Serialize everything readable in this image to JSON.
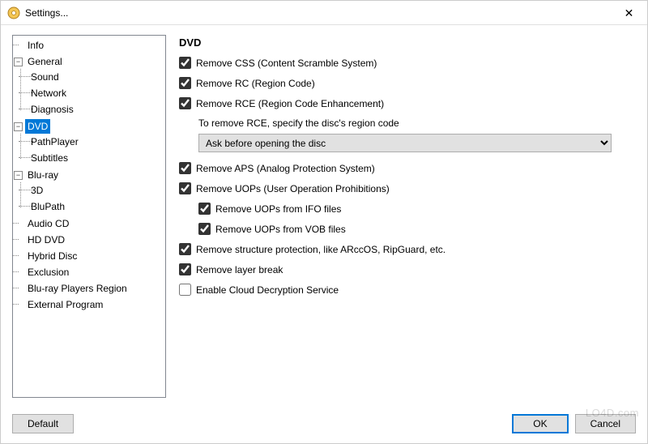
{
  "window": {
    "title": "Settings...",
    "close_symbol": "✕"
  },
  "tree": {
    "info": "Info",
    "general": "General",
    "general_children": {
      "sound": "Sound",
      "network": "Network",
      "diagnosis": "Diagnosis"
    },
    "dvd": "DVD",
    "dvd_children": {
      "pathplayer": "PathPlayer",
      "subtitles": "Subtitles"
    },
    "bluray": "Blu-ray",
    "bluray_children": {
      "threed": "3D",
      "blupath": "BluPath"
    },
    "audiocd": "Audio CD",
    "hddvd": "HD DVD",
    "hybrid": "Hybrid Disc",
    "exclusion": "Exclusion",
    "players_region": "Blu-ray Players Region",
    "external": "External Program",
    "expander_minus": "−"
  },
  "panel": {
    "heading": "DVD",
    "remove_css": "Remove CSS (Content Scramble System)",
    "remove_rc": "Remove RC (Region Code)",
    "remove_rce": "Remove RCE (Region Code Enhancement)",
    "rce_note": "To remove RCE, specify the disc's region code",
    "rce_select": "Ask before opening the disc",
    "remove_aps": "Remove APS (Analog Protection System)",
    "remove_uops": "Remove UOPs (User Operation Prohibitions)",
    "remove_uops_ifo": "Remove UOPs from IFO files",
    "remove_uops_vob": "Remove UOPs from VOB files",
    "remove_struct": "Remove structure protection, like ARccOS, RipGuard, etc.",
    "remove_layer": "Remove layer break",
    "enable_cloud": "Enable Cloud  Decryption Service"
  },
  "footer": {
    "default": "Default",
    "ok": "OK",
    "cancel": "Cancel"
  },
  "watermark": "LO4D.com"
}
